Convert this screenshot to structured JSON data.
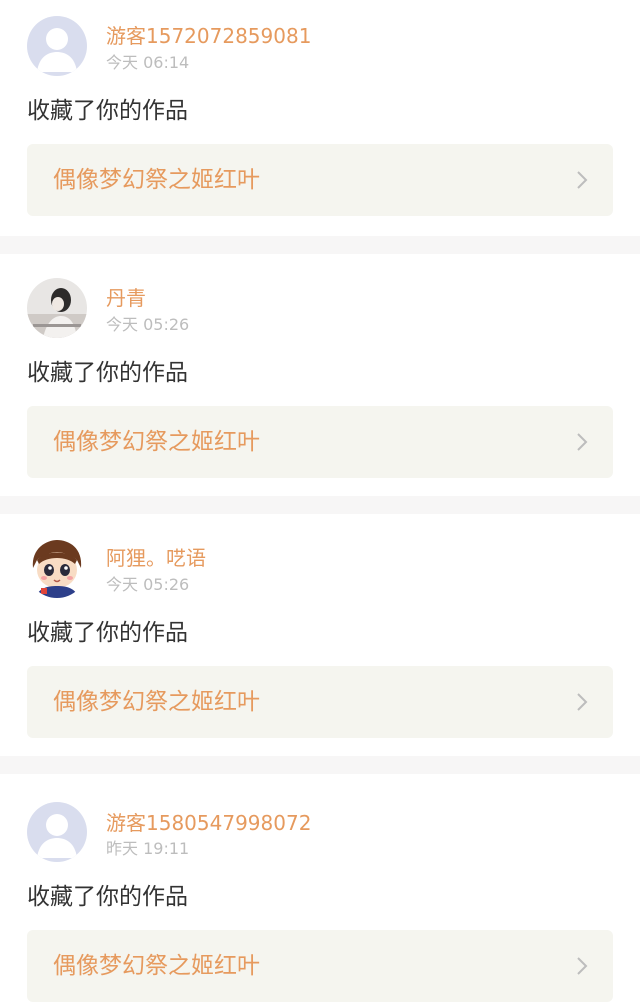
{
  "notifications": [
    {
      "username": "游客1572072859081",
      "time": "今天 06:14",
      "message": "收藏了你的作品",
      "work_title": "偶像梦幻祭之姬红叶",
      "avatar_type": "default-person-icon"
    },
    {
      "username": "丹青",
      "time": "今天 05:26",
      "message": "收藏了你的作品",
      "work_title": "偶像梦幻祭之姬红叶",
      "avatar_type": "photo-avatar"
    },
    {
      "username": "阿狸。呓语",
      "time": "今天 05:26",
      "message": "收藏了你的作品",
      "work_title": "偶像梦幻祭之姬红叶",
      "avatar_type": "cartoon-avatar"
    },
    {
      "username": "游客1580547998072",
      "time": "昨天 19:11",
      "message": "收藏了你的作品",
      "work_title": "偶像梦幻祭之姬红叶",
      "avatar_type": "default-person-icon"
    }
  ],
  "colors": {
    "accent": "#e69a5e",
    "muted": "#bdbdbd",
    "text": "#333333",
    "card_bg": "#f5f5ef",
    "separator": "#f7f6f6",
    "default_avatar_bg": "#d9ddee"
  }
}
